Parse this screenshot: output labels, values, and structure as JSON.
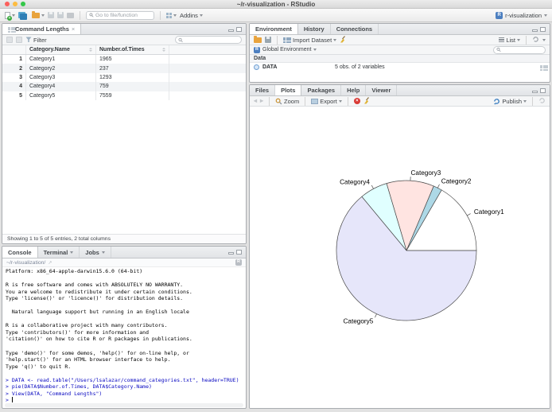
{
  "window": {
    "title": "~/r-visualization - RStudio",
    "project_label": "r-visualization"
  },
  "main_toolbar": {
    "goto_placeholder": "Go to file/function",
    "addins_label": "Addins"
  },
  "viewer_panel": {
    "tab_label": "Command Lengths",
    "filter_label": "Filter",
    "table": {
      "columns": [
        "Category.Name",
        "Number.of.Times"
      ],
      "rows": [
        [
          "1",
          "Category1",
          "1965"
        ],
        [
          "2",
          "Category2",
          "237"
        ],
        [
          "3",
          "Category3",
          "1293"
        ],
        [
          "4",
          "Category4",
          "759"
        ],
        [
          "5",
          "Category5",
          "7559"
        ]
      ]
    },
    "status": "Showing 1 to 5 of 5 entries, 2 total columns"
  },
  "console_panel": {
    "tabs": [
      {
        "label": "Console",
        "active": true
      },
      {
        "label": "Terminal",
        "caret": true
      },
      {
        "label": "Jobs",
        "caret": true
      }
    ],
    "path": "~/r-visualization/",
    "lines": [
      {
        "k": "o",
        "t": "Platform: x86_64-apple-darwin15.6.0 (64-bit)"
      },
      {
        "k": "o",
        "t": ""
      },
      {
        "k": "o",
        "t": "R is free software and comes with ABSOLUTELY NO WARRANTY."
      },
      {
        "k": "o",
        "t": "You are welcome to redistribute it under certain conditions."
      },
      {
        "k": "o",
        "t": "Type 'license()' or 'licence()' for distribution details."
      },
      {
        "k": "o",
        "t": ""
      },
      {
        "k": "o",
        "t": "  Natural language support but running in an English locale"
      },
      {
        "k": "o",
        "t": ""
      },
      {
        "k": "o",
        "t": "R is a collaborative project with many contributors."
      },
      {
        "k": "o",
        "t": "Type 'contributors()' for more information and"
      },
      {
        "k": "o",
        "t": "'citation()' on how to cite R or R packages in publications."
      },
      {
        "k": "o",
        "t": ""
      },
      {
        "k": "o",
        "t": "Type 'demo()' for some demos, 'help()' for on-line help, or"
      },
      {
        "k": "o",
        "t": "'help.start()' for an HTML browser interface to help."
      },
      {
        "k": "o",
        "t": "Type 'q()' to quit R."
      },
      {
        "k": "o",
        "t": ""
      },
      {
        "k": "c",
        "t": "> DATA <- read.table(\"/Users/lsalazar/command_categories.txt\", header=TRUE)"
      },
      {
        "k": "c",
        "t": "> pie(DATA$Number.of.Times, DATA$Category.Name)"
      },
      {
        "k": "c",
        "t": "> View(DATA, \"Command Lengths\")"
      },
      {
        "k": "c",
        "t": "> ",
        "cursor": true
      }
    ]
  },
  "environment_panel": {
    "tabs": [
      {
        "label": "Environment",
        "active": true
      },
      {
        "label": "History"
      },
      {
        "label": "Connections"
      }
    ],
    "import_label": "Import Dataset",
    "list_label": "List",
    "scope_label": "Global Environment",
    "section_label": "Data",
    "object": {
      "name": "DATA",
      "desc": "5 obs. of 2 variables"
    }
  },
  "plots_panel": {
    "tabs": [
      {
        "label": "Files"
      },
      {
        "label": "Plots",
        "active": true
      },
      {
        "label": "Packages"
      },
      {
        "label": "Help"
      },
      {
        "label": "Viewer"
      }
    ],
    "zoom_label": "Zoom",
    "export_label": "Export",
    "publish_label": "Publish"
  },
  "chart_data": {
    "type": "pie",
    "categories": [
      "Category1",
      "Category2",
      "Category3",
      "Category4",
      "Category5"
    ],
    "values": [
      1965,
      237,
      1293,
      759,
      7559
    ],
    "colors": [
      "#FFFFFF",
      "#ADD8E6",
      "#FFE4E1",
      "#E0FFFF",
      "#E6E6FA"
    ],
    "edge_color": "#4a4a4a",
    "label_color": "#000000",
    "start_angle_deg": 0,
    "direction": "counterclockwise",
    "legend_position": "labels-around-pie",
    "title": ""
  }
}
